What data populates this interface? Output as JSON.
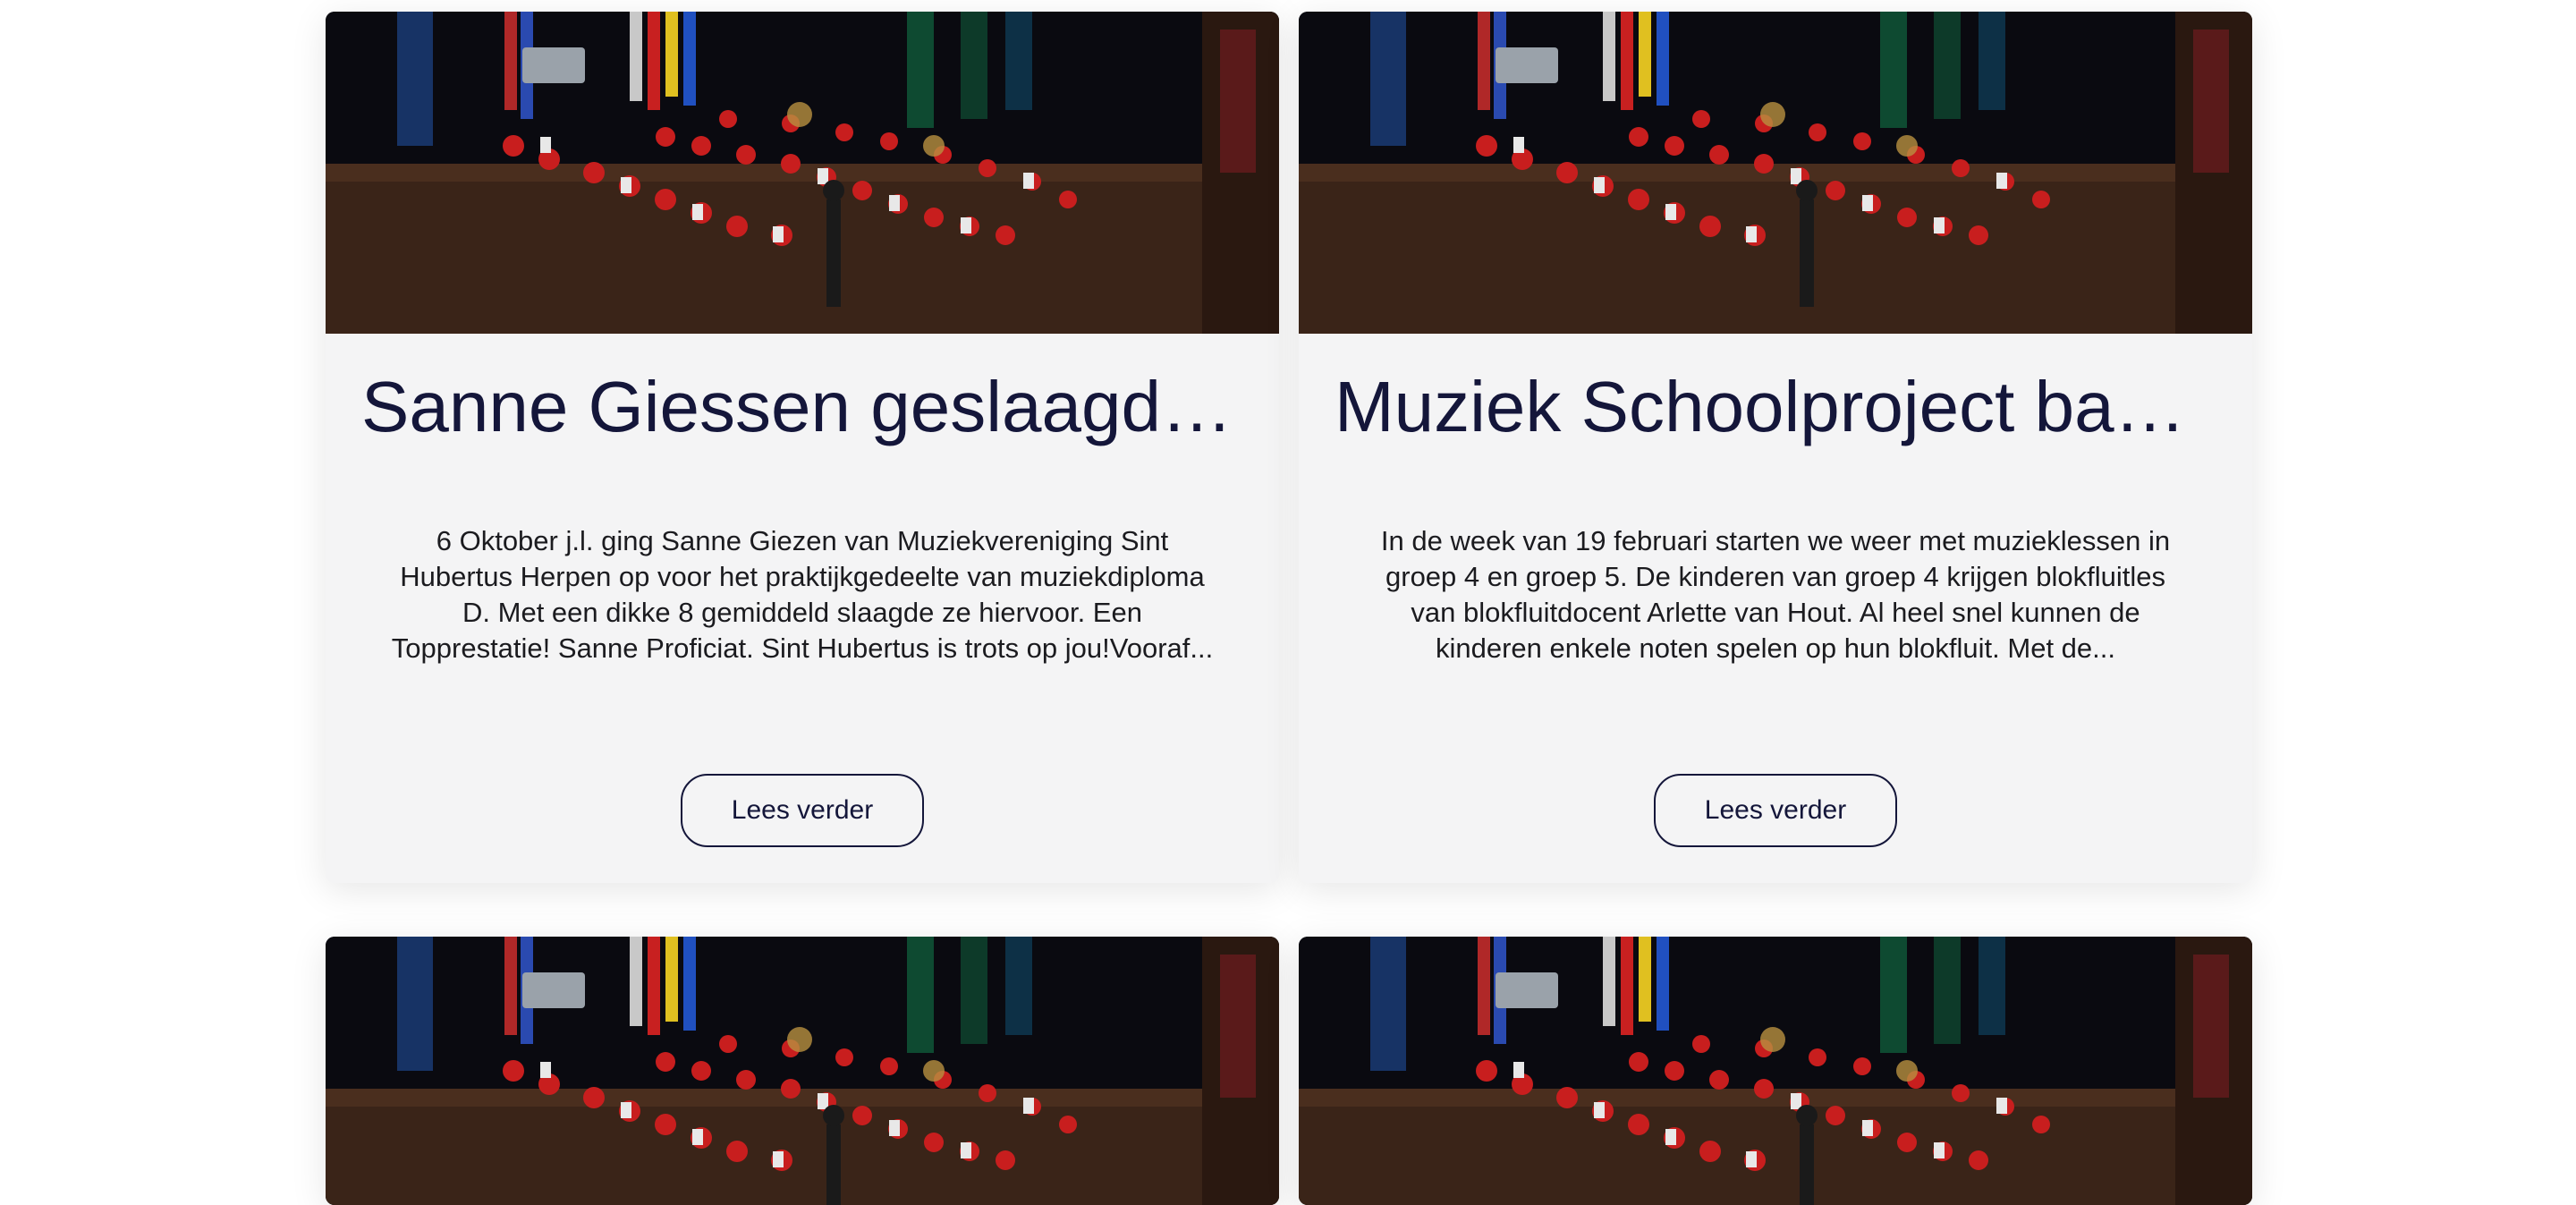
{
  "cards": [
    {
      "title": "Sanne Giessen geslaagd voor praktijkgedeelte muziekdiploma D",
      "excerpt": "6 Oktober j.l. ging Sanne Giezen van Muziekvereniging Sint Hubertus Herpen op voor het praktijkgedeelte van muziekdiploma D. Met een dikke 8 gemiddeld slaagde ze hiervoor. Een Topprestatie! Sanne Proficiat. Sint Hubertus is trots op jou!Vooraf...",
      "button": "Lees verder"
    },
    {
      "title": "Muziek Schoolproject basisschool",
      "excerpt": "In de week van 19 februari starten we weer met muzieklessen in groep 4 en groep 5. De kinderen van groep 4 krijgen blokfluitles van blokfluitdocent Arlette van Hout. Al heel snel kunnen de kinderen enkele noten spelen op hun blokfluit. Met de...",
      "button": "Lees verder"
    }
  ],
  "colors": {
    "title": "#14163a",
    "card_bg": "#f4f4f5",
    "button_border": "#14163a"
  }
}
